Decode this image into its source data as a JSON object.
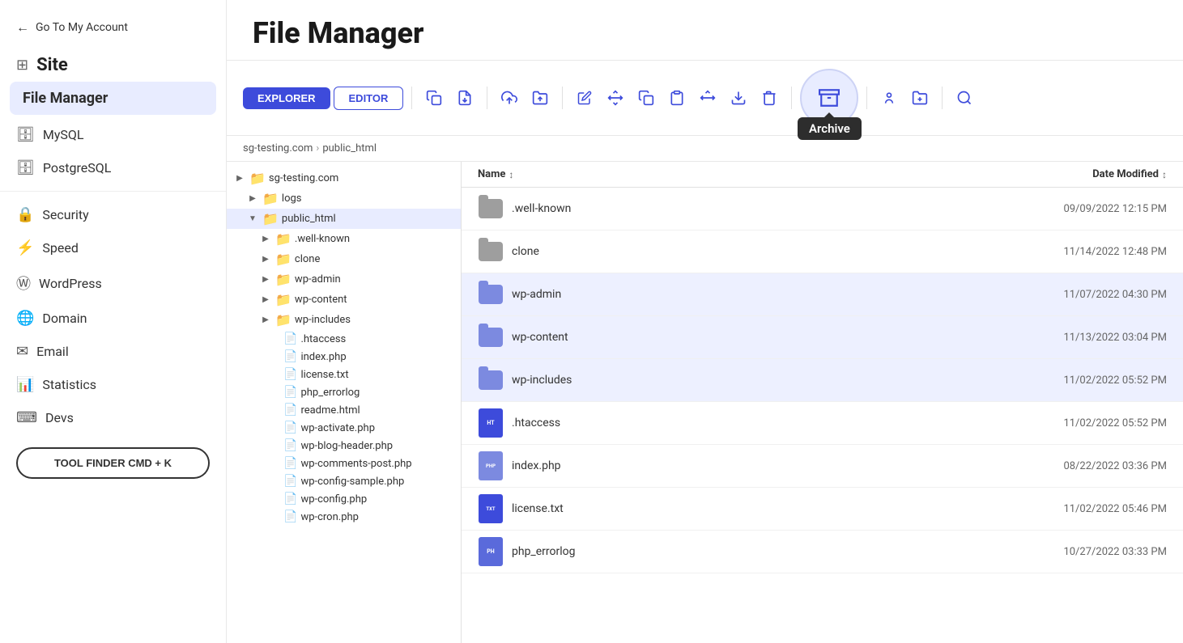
{
  "sidebar": {
    "back_label": "Go To My Account",
    "site_label": "Site",
    "active_item": "File Manager",
    "items": [
      {
        "id": "mysql",
        "icon": "🗄",
        "label": "MySQL"
      },
      {
        "id": "postgresql",
        "icon": "🗄",
        "label": "PostgreSQL"
      },
      {
        "id": "security",
        "icon": "🔒",
        "label": "Security"
      },
      {
        "id": "speed",
        "icon": "⚡",
        "label": "Speed"
      },
      {
        "id": "wordpress",
        "icon": "Ⓦ",
        "label": "WordPress"
      },
      {
        "id": "domain",
        "icon": "🌐",
        "label": "Domain"
      },
      {
        "id": "email",
        "icon": "✉",
        "label": "Email"
      },
      {
        "id": "statistics",
        "icon": "📊",
        "label": "Statistics"
      },
      {
        "id": "devs",
        "icon": "⌨",
        "label": "Devs"
      }
    ],
    "tool_finder_label": "TOOL FINDER CMD + K"
  },
  "header": {
    "title": "File Manager"
  },
  "toolbar": {
    "explorer_label": "EXPLORER",
    "editor_label": "EDITOR",
    "archive_tooltip": "Archive"
  },
  "breadcrumb": {
    "domain": "sg-testing.com",
    "separator": "›",
    "folder": "public_html"
  },
  "file_list": {
    "col_name": "Name",
    "col_date": "Date Modified",
    "files": [
      {
        "id": "well-known",
        "type": "folder",
        "name": ".well-known",
        "date": "09/09/2022 12:15 PM",
        "selected": false
      },
      {
        "id": "clone",
        "type": "folder",
        "name": "clone",
        "date": "11/14/2022 12:48 PM",
        "selected": false
      },
      {
        "id": "wp-admin",
        "type": "folder",
        "name": "wp-admin",
        "date": "11/07/2022 04:30 PM",
        "selected": true
      },
      {
        "id": "wp-content",
        "type": "folder",
        "name": "wp-content",
        "date": "11/13/2022 03:04 PM",
        "selected": true
      },
      {
        "id": "wp-includes",
        "type": "folder",
        "name": "wp-includes",
        "date": "11/02/2022 05:52 PM",
        "selected": true
      },
      {
        "id": "htaccess",
        "type": "file",
        "badge": "HT",
        "badge_class": "badge-ht",
        "name": ".htaccess",
        "date": "11/02/2022 05:52 PM",
        "selected": false
      },
      {
        "id": "index-php",
        "type": "file",
        "badge": "PHP",
        "badge_class": "badge-php",
        "name": "index.php",
        "date": "08/22/2022 03:36 PM",
        "selected": false
      },
      {
        "id": "license-txt",
        "type": "file",
        "badge": "TXT",
        "badge_class": "badge-txt",
        "name": "license.txt",
        "date": "11/02/2022 05:46 PM",
        "selected": false
      },
      {
        "id": "php-errorlog",
        "type": "file",
        "badge": "PH",
        "badge_class": "badge-log",
        "name": "php_errorlog",
        "date": "10/27/2022 03:33 PM",
        "selected": false
      }
    ]
  },
  "tree": {
    "items": [
      {
        "indent": 0,
        "type": "folder",
        "expanded": false,
        "label": "sg-testing.com",
        "selected": false
      },
      {
        "indent": 1,
        "type": "folder",
        "expanded": false,
        "label": "logs",
        "selected": false
      },
      {
        "indent": 1,
        "type": "folder",
        "expanded": true,
        "label": "public_html",
        "selected": true,
        "blue": true
      },
      {
        "indent": 2,
        "type": "folder",
        "expanded": false,
        "label": ".well-known",
        "selected": false
      },
      {
        "indent": 2,
        "type": "folder",
        "expanded": false,
        "label": "clone",
        "selected": false
      },
      {
        "indent": 2,
        "type": "folder",
        "expanded": false,
        "label": "wp-admin",
        "selected": false
      },
      {
        "indent": 2,
        "type": "folder",
        "expanded": false,
        "label": "wp-content",
        "selected": false
      },
      {
        "indent": 2,
        "type": "folder",
        "expanded": false,
        "label": "wp-includes",
        "selected": false
      },
      {
        "indent": 2,
        "type": "file",
        "label": ".htaccess",
        "selected": false
      },
      {
        "indent": 2,
        "type": "file",
        "label": "index.php",
        "selected": false
      },
      {
        "indent": 2,
        "type": "file",
        "label": "license.txt",
        "selected": false
      },
      {
        "indent": 2,
        "type": "file",
        "label": "php_errorlog",
        "selected": false
      },
      {
        "indent": 2,
        "type": "file",
        "label": "readme.html",
        "selected": false
      },
      {
        "indent": 2,
        "type": "file",
        "label": "wp-activate.php",
        "selected": false
      },
      {
        "indent": 2,
        "type": "file",
        "label": "wp-blog-header.php",
        "selected": false
      },
      {
        "indent": 2,
        "type": "file",
        "label": "wp-comments-post.php",
        "selected": false
      },
      {
        "indent": 2,
        "type": "file",
        "label": "wp-config-sample.php",
        "selected": false
      },
      {
        "indent": 2,
        "type": "file",
        "label": "wp-config.php",
        "selected": false
      },
      {
        "indent": 2,
        "type": "file",
        "label": "wp-cron.php",
        "selected": false
      }
    ]
  },
  "icons": {
    "back_arrow": "←",
    "grid": "⊞",
    "copy_file": "⧉",
    "move_file": "⤴",
    "upload": "⬆",
    "download_folder": "⬇",
    "edit": "✏",
    "move": "⇄",
    "duplicate": "❏",
    "paste": "📋",
    "move_arrows": "⤢",
    "download": "⬇",
    "delete": "🗑",
    "archive": "📦",
    "permissions": "🔑",
    "new_folder": "📁",
    "search": "🔍",
    "sort": "↕"
  }
}
